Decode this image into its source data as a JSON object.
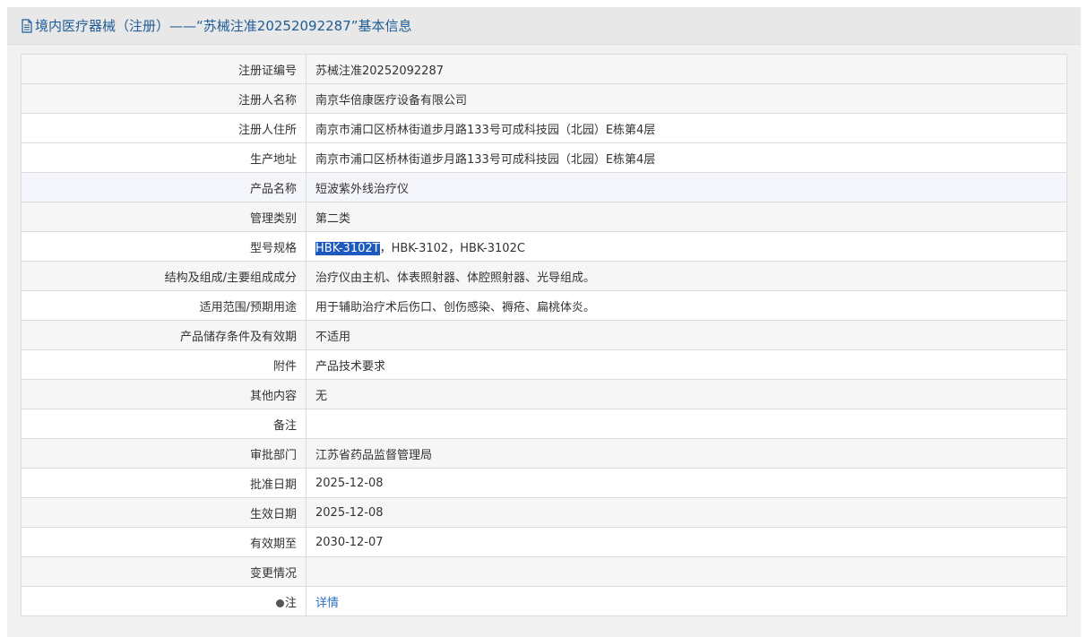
{
  "header": {
    "title": "境内医疗器械（注册）——“苏械注准20252092287”基本信息"
  },
  "rows": [
    {
      "label": "注册证编号",
      "value": "苏械注准20252092287"
    },
    {
      "label": "注册人名称",
      "value": "南京华倍康医疗设备有限公司"
    },
    {
      "label": "注册人住所",
      "value": "南京市浦口区桥林街道步月路133号可成科技园（北园）E栋第4层"
    },
    {
      "label": "生产地址",
      "value": "南京市浦口区桥林街道步月路133号可成科技园（北园）E栋第4层"
    },
    {
      "label": "产品名称",
      "value": "短波紫外线治疗仪"
    },
    {
      "label": "管理类别",
      "value": "第二类"
    },
    {
      "label": "型号规格",
      "value_selected": "HBK-3102T",
      "value_rest": "，HBK-3102，HBK-3102C"
    },
    {
      "label": "结构及组成/主要组成成分",
      "value": "治疗仪由主机、体表照射器、体腔照射器、光导组成。"
    },
    {
      "label": "适用范围/预期用途",
      "value": "用于辅助治疗术后伤口、创伤感染、褥疮、扁桃体炎。"
    },
    {
      "label": "产品储存条件及有效期",
      "value": "不适用"
    },
    {
      "label": "附件",
      "value": "产品技术要求"
    },
    {
      "label": "其他内容",
      "value": "无"
    },
    {
      "label": "备注",
      "value": ""
    },
    {
      "label": "审批部门",
      "value": "江苏省药品监督管理局"
    },
    {
      "label": "批准日期",
      "value": "2025-12-08"
    },
    {
      "label": "生效日期",
      "value": "2025-12-08"
    },
    {
      "label": "有效期至",
      "value": "2030-12-07"
    },
    {
      "label": "变更情况",
      "value": ""
    },
    {
      "label": "注",
      "value": "详情"
    }
  ],
  "icons": {
    "header_icon": "document-icon",
    "note_icon": "info-bubble-icon"
  },
  "colors": {
    "header_text": "#1f5d96",
    "link": "#2d6fc1",
    "selection": "#1e59bd"
  }
}
